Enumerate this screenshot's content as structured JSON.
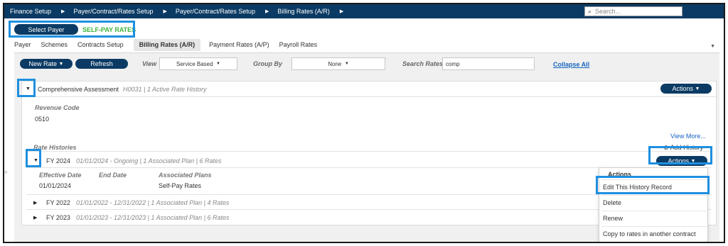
{
  "topbar": {
    "breadcrumbs": [
      "Finance Setup",
      "Payer/Contract/Rates Setup",
      "Payer/Contract/Rates Setup",
      "Billing Rates (A/R)"
    ],
    "search_placeholder": "Search...",
    "search_icon": "search-icon"
  },
  "payer": {
    "select_label": "Select Payer",
    "name": "SELF-PAY RATES"
  },
  "tabs": [
    "Payer",
    "Schemes",
    "Contracts Setup",
    "Billing Rates (A/R)",
    "Payment Rates (A/P)",
    "Payroll Rates"
  ],
  "active_tab": "Billing Rates (A/R)",
  "toolbar": {
    "new_rate": "New Rate",
    "refresh": "Refresh",
    "view_label": "View",
    "view_value": "Service Based",
    "group_label": "Group By",
    "group_value": "None",
    "search_rates_label": "Search Rates",
    "search_rates_value": "comp",
    "collapse_all": "Collapse All"
  },
  "service": {
    "name": "Comprehensive Assessment",
    "meta": "H0031 | 1 Active Rate History",
    "actions": "Actions",
    "revenue_code_label": "Revenue Code",
    "revenue_code": "0510",
    "view_more": "View More...",
    "rate_histories_label": "Rate Histories",
    "add_history": "Add History"
  },
  "histories": [
    {
      "fy": "FY 2024",
      "meta": "01/01/2024 - Ongoing | 1 Associated Plan | 6 Rates",
      "expanded": true
    },
    {
      "fy": "FY 2022",
      "meta": "01/01/2022 - 12/31/2022 | 1 Associated Plan | 4 Rates",
      "expanded": false
    },
    {
      "fy": "FY 2023",
      "meta": "01/01/2023 - 12/31/2023 | 1 Associated Plan | 6 Rates",
      "expanded": false
    }
  ],
  "detail": {
    "headers": [
      "Effective Date",
      "End Date",
      "Associated Plans"
    ],
    "row": [
      "01/01/2024",
      "",
      "Self-Pay Rates"
    ]
  },
  "row_actions": "Actions",
  "menu": {
    "title": "Actions",
    "items": [
      "Edit This History Record",
      "Delete",
      "Renew",
      "Copy to rates in another contract"
    ]
  },
  "colors": {
    "navy": "#0b3b64",
    "highlight": "#1e8fe0",
    "selfpay": "#3cb43c",
    "link": "#1565c0"
  }
}
